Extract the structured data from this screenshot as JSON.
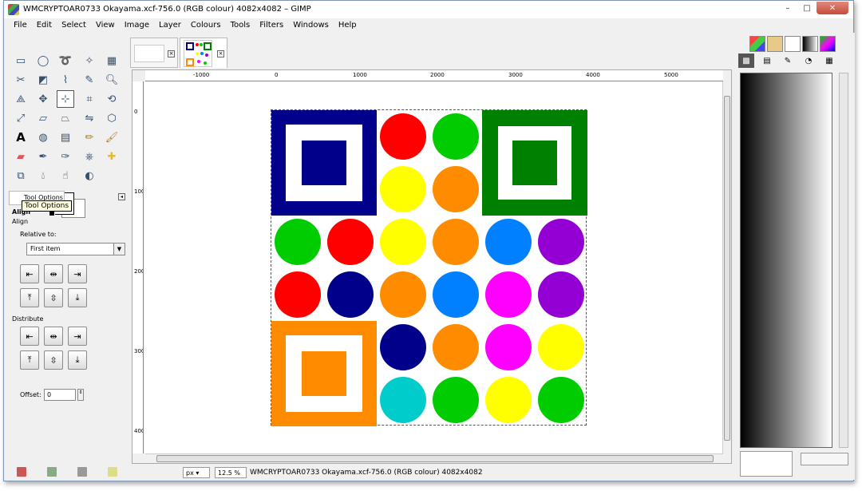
{
  "window": {
    "title": "WMCRYPTOAR0733 Okayama.xcf-756.0 (RGB colour) 4082x4082 – GIMP",
    "minimize": "–",
    "maximize": "□",
    "close": "✕"
  },
  "menu": [
    "File",
    "Edit",
    "Select",
    "View",
    "Image",
    "Layer",
    "Colours",
    "Tools",
    "Filters",
    "Windows",
    "Help"
  ],
  "tool_options": {
    "tab_label": "Tool Options",
    "tooltip": "Tool Options",
    "heading": "Align",
    "subheading": "Align",
    "relative_label": "Relative to:",
    "relative_value": "First item",
    "distribute_label": "Distribute",
    "offset_label": "Offset:",
    "offset_value": "0"
  },
  "rulers": {
    "h_ticks": [
      "-1000",
      "0",
      "1000",
      "2000",
      "3000",
      "4000",
      "5000"
    ],
    "v_ticks": [
      "0",
      "1000",
      "2000",
      "3000",
      "4000"
    ]
  },
  "status": {
    "unit": "px",
    "zoom": "12.5 %",
    "text": "WMCRYPTOAR0733 Okayama.xcf-756.0 (RGB colour) 4082x4082"
  },
  "colors": {
    "navy": "#00008b",
    "green": "#008000",
    "orange": "#ff8c00",
    "red": "#ff0000",
    "lime": "#00cc00",
    "yellow": "#ffff00",
    "blue": "#0080ff",
    "purple": "#9400d3",
    "magenta": "#ff00ff",
    "cyan": "#00cccc"
  }
}
